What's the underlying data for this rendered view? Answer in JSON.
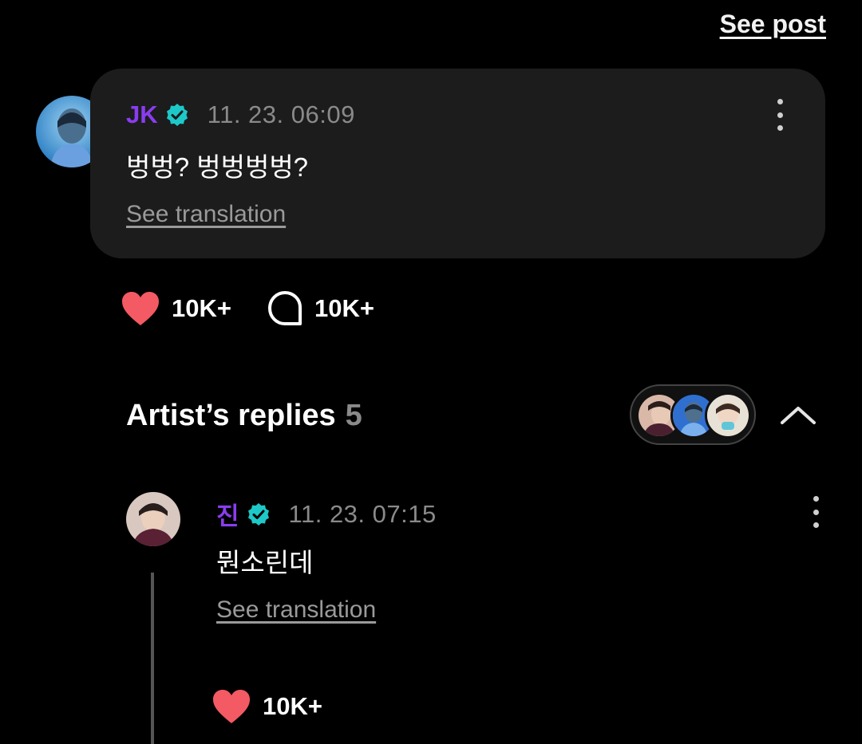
{
  "header": {
    "see_post_label": "See post"
  },
  "comment": {
    "author": "JK",
    "timestamp": "11. 23. 06:09",
    "text": "벙벙? 벙벙벙벙?",
    "translate_label": "See translation",
    "likes": "10K+",
    "replies_count_label": "10K+"
  },
  "artist_replies": {
    "title": "Artist’s replies",
    "count": "5"
  },
  "reply": {
    "author": "진",
    "timestamp": "11. 23. 07:15",
    "text": "뭔소린데",
    "translate_label": "See translation",
    "likes": "10K+"
  },
  "colors": {
    "background": "#000000",
    "card": "#1c1c1c",
    "author_purple": "#8a3cf0",
    "verified_teal": "#1ec8c8",
    "heart_red": "#f35a63",
    "muted_text": "#8a8a8a"
  }
}
